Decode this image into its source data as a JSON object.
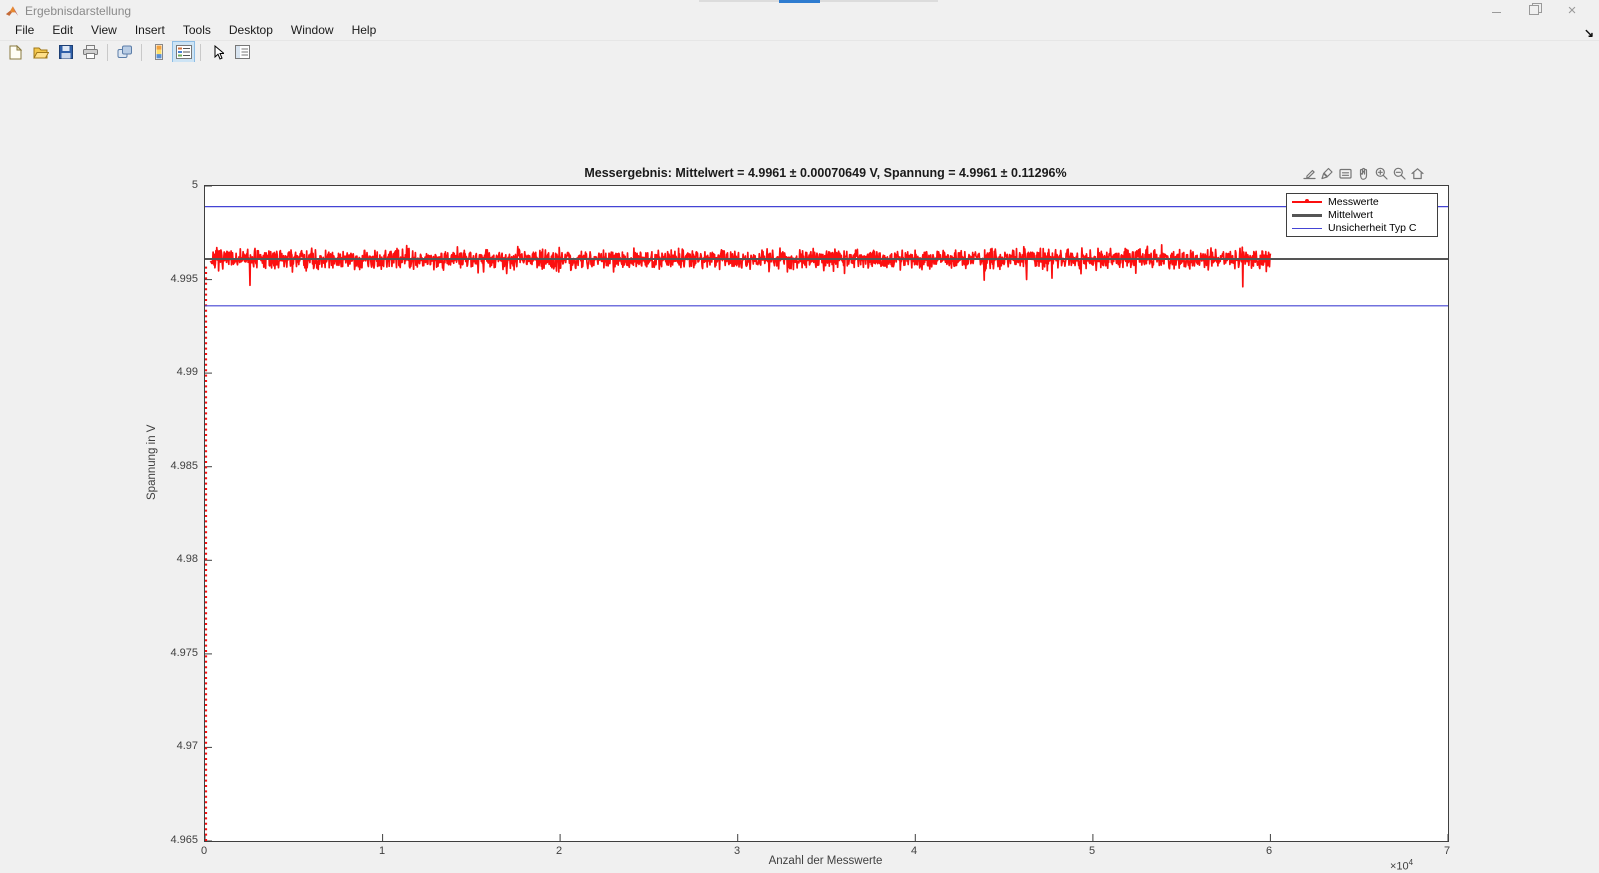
{
  "window": {
    "title": "Ergebnisdarstellung",
    "controls": {
      "minimize_icon": "minimize",
      "restore_icon": "restore-down",
      "close_icon": "close",
      "close_glyph": "×"
    }
  },
  "menu": {
    "items": [
      {
        "label": "File"
      },
      {
        "label": "Edit"
      },
      {
        "label": "View"
      },
      {
        "label": "Insert"
      },
      {
        "label": "Tools"
      },
      {
        "label": "Desktop"
      },
      {
        "label": "Window"
      },
      {
        "label": "Help"
      }
    ]
  },
  "toolbar": {
    "buttons": [
      {
        "icon": "new-figure-icon"
      },
      {
        "icon": "open-file-icon"
      },
      {
        "icon": "save-figure-icon"
      },
      {
        "icon": "print-figure-icon"
      },
      {
        "icon": "link-plot-icon"
      },
      {
        "icon": "insert-colorbar-icon"
      },
      {
        "icon": "insert-legend-icon",
        "active": true
      },
      {
        "icon": "edit-plot-arrow-icon"
      },
      {
        "icon": "plot-browser-icon"
      }
    ],
    "dock_arrow_glyph": "↘"
  },
  "axes_toolbar": {
    "icons": [
      "export-icon",
      "brush-icon",
      "datatip-icon",
      "pan-icon",
      "zoom-in-icon",
      "zoom-out-icon",
      "restore-view-icon"
    ]
  },
  "chart_data": {
    "type": "line",
    "title": "Messergebnis: Mittelwert = 4.9961 ± 0.00070649 V, Spannung = 4.9961 ± 0.11296%",
    "xlabel": "Anzahl der Messwerte",
    "ylabel": "Spannung in V",
    "xlim": [
      0,
      70000
    ],
    "ylim": [
      4.965,
      5
    ],
    "grid": false,
    "x_tick_values": [
      0,
      10000,
      20000,
      30000,
      40000,
      50000,
      60000,
      70000
    ],
    "x_tick_labels": [
      "0",
      "1",
      "2",
      "3",
      "4",
      "5",
      "6",
      "7"
    ],
    "x_multiplier_base": "×10",
    "x_multiplier_exponent": "4",
    "y_tick_values": [
      5,
      4.995,
      4.99,
      4.985,
      4.98,
      4.975,
      4.97,
      4.965
    ],
    "y_tick_labels": [
      "5",
      "4.995",
      "4.99",
      "4.985",
      "4.98",
      "4.975",
      "4.97",
      "4.965"
    ],
    "mittelwert": 4.9961,
    "mittelwert_unsicherheit_V": 0.00070649,
    "spannung_unsicherheit_prozent": 0.11296,
    "legend": {
      "position": "northeast",
      "entries": [
        {
          "label": "Messwerte",
          "color": "#fb0f0f",
          "marker": "dot"
        },
        {
          "label": "Mittelwert",
          "color": "#555555"
        },
        {
          "label": "Unsicherheit Typ C",
          "color": "#4444d4"
        }
      ]
    },
    "series": [
      {
        "name": "Messwerte",
        "type": "noisy-line",
        "color": "#fb0f0f",
        "x_range": [
          300,
          60000
        ],
        "mean": 4.9961,
        "noise_std": 0.00045,
        "observed_min": 4.9948,
        "observed_max": 4.9975,
        "render_points": 2300,
        "seed": 7,
        "initial_transient": {
          "x": 0,
          "from": 4.965,
          "to": 4.9958,
          "style": "dotted-vertical"
        }
      },
      {
        "name": "Mittelwert",
        "type": "hline",
        "color": "#555555",
        "value": 4.9961,
        "stroke_width": 2
      },
      {
        "name": "Unsicherheit Typ C",
        "type": "hline-pair",
        "color": "#4444d4",
        "values": [
          4.9989,
          4.9936
        ],
        "stroke_width": 1.2
      }
    ]
  }
}
